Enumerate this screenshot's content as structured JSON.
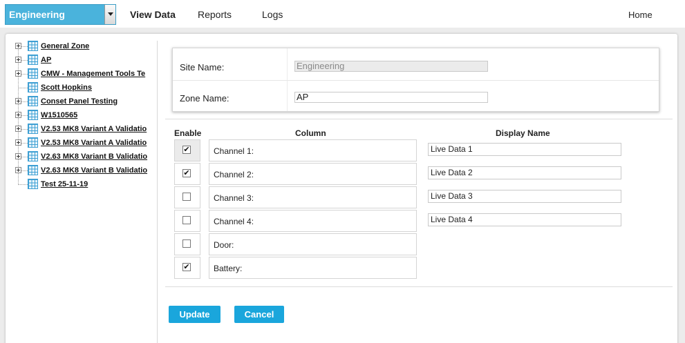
{
  "topbar": {
    "site_select": "Engineering",
    "nav": {
      "view_data": "View Data",
      "reports": "Reports",
      "logs": "Logs",
      "home": "Home"
    }
  },
  "tree": {
    "items": [
      {
        "label": "General Zone",
        "expandable": true
      },
      {
        "label": "AP",
        "expandable": true
      },
      {
        "label": "CMW - Management Tools Te",
        "expandable": true
      },
      {
        "label": "Scott Hopkins",
        "expandable": false
      },
      {
        "label": "Conset Panel Testing",
        "expandable": true
      },
      {
        "label": "W1510565",
        "expandable": true
      },
      {
        "label": "V2.53 MK8 Variant A Validatio",
        "expandable": true
      },
      {
        "label": "V2.53 MK8 Variant A Validatio",
        "expandable": true
      },
      {
        "label": "V2.63 MK8 Variant B Validatio",
        "expandable": true
      },
      {
        "label": "V2.63 MK8 Variant B Validatio",
        "expandable": true
      },
      {
        "label": "Test 25-11-19",
        "expandable": false
      }
    ]
  },
  "site_card": {
    "site_name_label": "Site Name:",
    "site_name_value": "Engineering",
    "zone_name_label": "Zone Name:",
    "zone_name_value": "AP"
  },
  "channels": {
    "headers": {
      "enable": "Enable",
      "column": "Column",
      "display_name": "Display Name"
    },
    "rows": [
      {
        "column": "Channel 1:",
        "enabled": true,
        "display": "Live Data 1",
        "check": "✔"
      },
      {
        "column": "Channel 2:",
        "enabled": true,
        "display": "Live Data 2",
        "check": "✔"
      },
      {
        "column": "Channel 3:",
        "enabled": false,
        "display": "Live Data 3",
        "check": ""
      },
      {
        "column": "Channel 4:",
        "enabled": false,
        "display": "Live Data 4",
        "check": ""
      },
      {
        "column": "Door:",
        "enabled": false,
        "display": "",
        "check": ""
      },
      {
        "column": "Battery:",
        "enabled": true,
        "display": "",
        "check": "✔"
      }
    ]
  },
  "buttons": {
    "update": "Update",
    "cancel": "Cancel"
  },
  "colors": {
    "accent": "#1aa6dc",
    "select_bg": "#4ab3dc"
  }
}
